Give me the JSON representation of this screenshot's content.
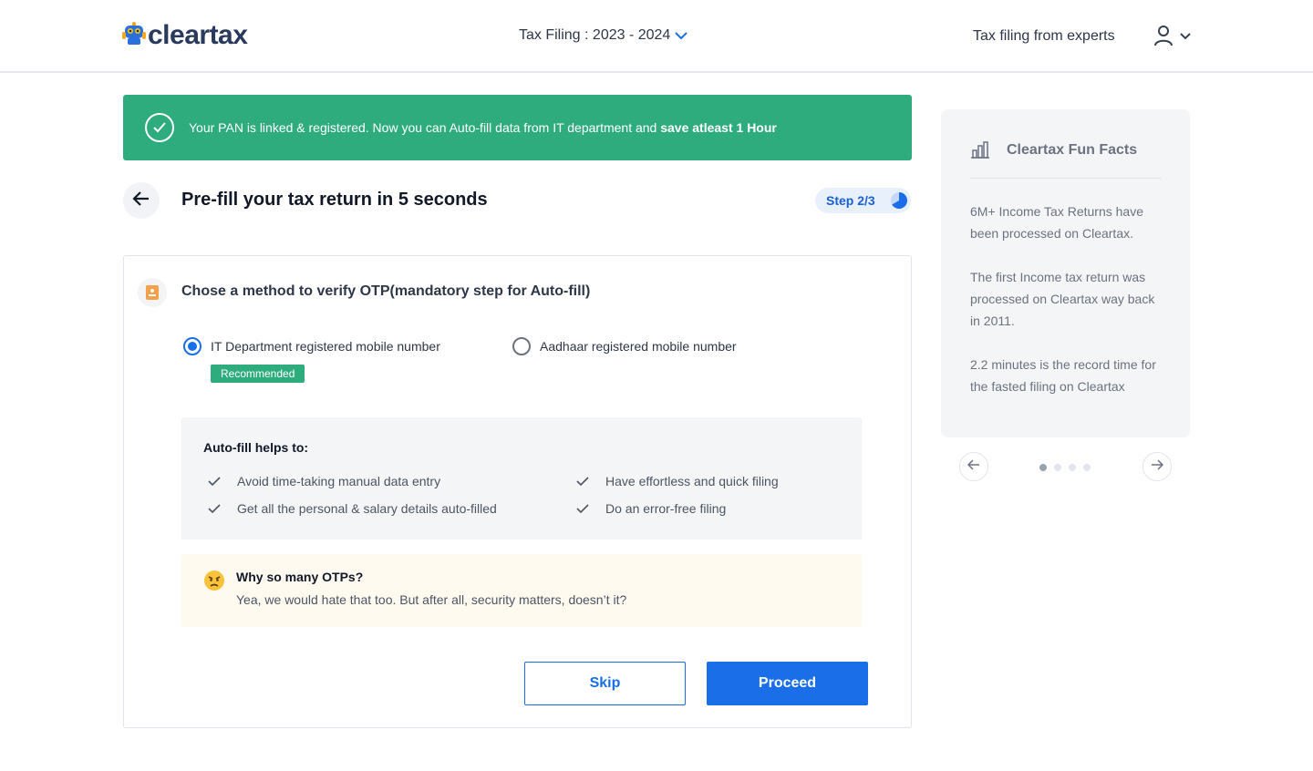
{
  "header": {
    "logo_text": "cleartax",
    "year_selector": "Tax Filing : 2023 - 2024",
    "experts_link": "Tax filing from experts"
  },
  "banner": {
    "text": "Your PAN is linked & registered. Now you can Auto-fill data from IT department and",
    "bold_text": "save atleast 1 Hour"
  },
  "page": {
    "title": "Pre-fill your tax return in 5 seconds",
    "step": "Step 2/3",
    "step_progress": 0.6667
  },
  "card": {
    "title": "Chose a method to verify OTP(mandatory step for Auto-fill)",
    "options": [
      {
        "label": "IT Department registered mobile number",
        "selected": true,
        "badge": "Recommended"
      },
      {
        "label": "Aadhaar registered mobile number",
        "selected": false
      }
    ],
    "helps": {
      "title": "Auto-fill helps to:",
      "items": [
        "Avoid time-taking manual data entry",
        "Get all the personal & salary details auto-filled",
        "Have effortless and quick filing",
        "Do an error-free filing"
      ]
    },
    "otp_note": {
      "question": "Why so many OTPs?",
      "answer": "Yea, we would hate that too. But after all, security matters, doesn’t it?"
    },
    "skip_label": "Skip",
    "proceed_label": "Proceed"
  },
  "fun_facts": {
    "title": "Cleartax Fun Facts",
    "facts": [
      "6M+ Income Tax Returns have been processed on Cleartax.",
      "The first Income tax return was processed on Cleartax way back in 2011.",
      "2.2 minutes is the record time for the fasted filing on Cleartax"
    ],
    "active_dot": 0,
    "dot_count": 4
  },
  "colors": {
    "brand_blue": "#1a6fe8",
    "success_green": "#2eac7e",
    "note_bg": "#fffaf0"
  }
}
